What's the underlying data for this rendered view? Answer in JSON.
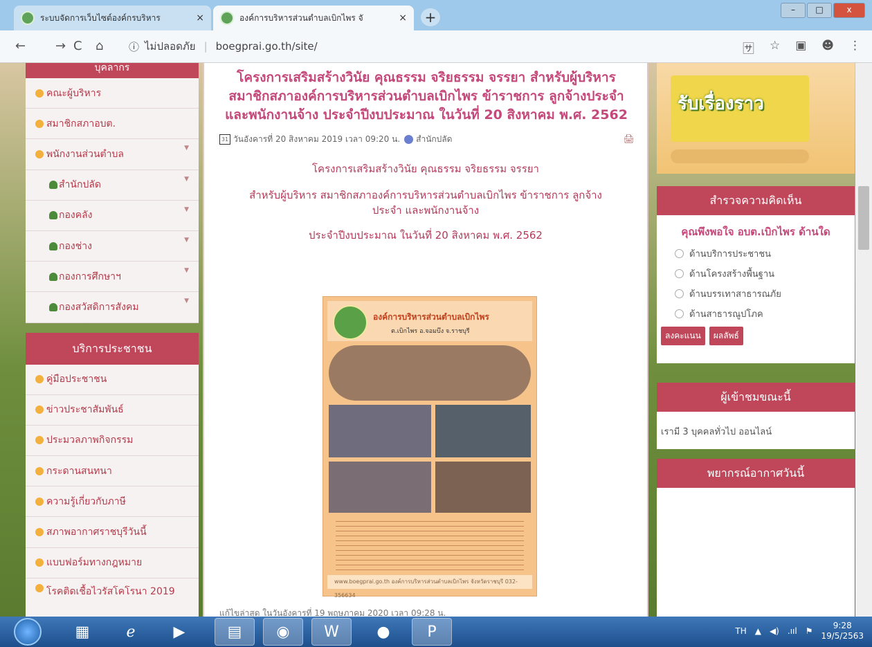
{
  "browser": {
    "tabs": [
      {
        "title": "ระบบจัดการเว็บไซต์องค์กรบริหาร"
      },
      {
        "title": "องค์การบริหารส่วนตำบลเบิกไพร จั"
      }
    ],
    "new_tab": "+",
    "close_glyph": "×",
    "nav": {
      "back": "←",
      "forward": "→",
      "reload": "C",
      "home": "⌂"
    },
    "security": "ไม่ปลอดภัย",
    "security_icon": "ⓘ",
    "url": "boegprai.go.th/site/",
    "right_icons": [
      "translate-icon",
      "star-icon",
      "extension-icon",
      "account-icon",
      "menu-icon"
    ],
    "window_buttons": [
      "–",
      "□",
      "x"
    ]
  },
  "left_sidebar": {
    "top_header": "บุคลากร",
    "personnel": [
      {
        "label": "คณะผู้บริหาร",
        "sub": false,
        "caret": false
      },
      {
        "label": "สมาชิกสภาอบต.",
        "sub": false,
        "caret": false
      },
      {
        "label": "พนักงานส่วนตำบล",
        "sub": false,
        "caret": true
      },
      {
        "label": "สำนักปลัด",
        "sub": true,
        "caret": true
      },
      {
        "label": "กองคลัง",
        "sub": true,
        "caret": true
      },
      {
        "label": "กองช่าง",
        "sub": true,
        "caret": true
      },
      {
        "label": "กองการศึกษาฯ",
        "sub": true,
        "caret": true
      },
      {
        "label": "กองสวัสดิการสังคม",
        "sub": true,
        "caret": true
      }
    ],
    "services_header": "บริการประชาชน",
    "services": [
      {
        "label": "คู่มือประชาชน"
      },
      {
        "label": "ข่าวประชาสัมพันธ์"
      },
      {
        "label": "ประมวลภาพกิจกรรม"
      },
      {
        "label": "กระดานสนทนา"
      },
      {
        "label": "ความรู้เกี่ยวกับภาษี"
      },
      {
        "label": "สภาพอากาศราชบุรีวันนี้"
      },
      {
        "label": "แบบฟอร์มทางกฎหมาย"
      },
      {
        "label": "โรคติดเชื้อไวรัสโคโรนา 2019"
      }
    ]
  },
  "article": {
    "title": "โครงการเสริมสร้างวินัย คุณธรรม จริยธรรม จรรยา สำหรับผู้บริหาร สมาชิกสภาองค์การบริหารส่วนตำบลเบิกไพร ข้าราชการ ลูกจ้างประจำ และพนักงานจ้าง ประจำปีงบประมาณ ในวันที่ 20 สิงหาคม พ.ศ. 2562",
    "calendar_num": "31",
    "date": "วันอังคารที่ 20 สิงหาคม 2019 เวลา 09:20 น.",
    "author": "สำนักปลัด",
    "body": [
      "โครงการเสริมสร้างวินัย คุณธรรม จริยธรรม จรรยา",
      "สำหรับผู้บริหาร สมาชิกสภาองค์การบริหารส่วนตำบลเบิกไพร ข้าราชการ ลูกจ้างประจำ และพนักงานจ้าง",
      "ประจำปีงบประมาณ ในวันที่ 20 สิงหาคม พ.ศ. 2562"
    ],
    "poster": {
      "heading": "องค์การบริหารส่วนตำบลเบิกไพร",
      "subheading": "ต.เบิกไพร อ.จอมบึง จ.ราชบุรี",
      "footer": "www.boegprai.go.th   องค์การบริหารส่วนตำบลเบิกไพร จังหวัดราชบุรี   032-356634"
    },
    "updated": "แก้ไขล่าสุด ในวันอังคารที่ 19 พฤษภาคม 2020 เวลา 09:28 น."
  },
  "right_sidebar": {
    "banner_text": "รับเรื่องราว",
    "poll": {
      "header": "สำรวจความคิดเห็น",
      "question": "คุณพึงพอใจ อบต.เบิกไพร ด้านใด",
      "options": [
        "ด้านบริการประชาชน",
        "ด้านโครงสร้างพื้นฐาน",
        "ด้านบรรเทาสาธารณภัย",
        "ด้านสาธารณูปโภค"
      ],
      "vote_button": "ลงคะแนน",
      "results_button": "ผลลัพธ์"
    },
    "online": {
      "header": "ผู้เข้าชมขณะนี้",
      "text": "เรามี 3 บุคคลทั่วไป ออนไลน์"
    },
    "weather": {
      "header": "พยากรณ์อากาศวันนี้"
    }
  },
  "taskbar": {
    "apps": [
      "explorer-icon",
      "ie-icon",
      "media-icon",
      "folder-icon",
      "chrome-icon",
      "word-icon",
      "paint-icon",
      "powerpoint-icon"
    ],
    "language": "TH",
    "time": "9:28",
    "date": "19/5/2563"
  }
}
